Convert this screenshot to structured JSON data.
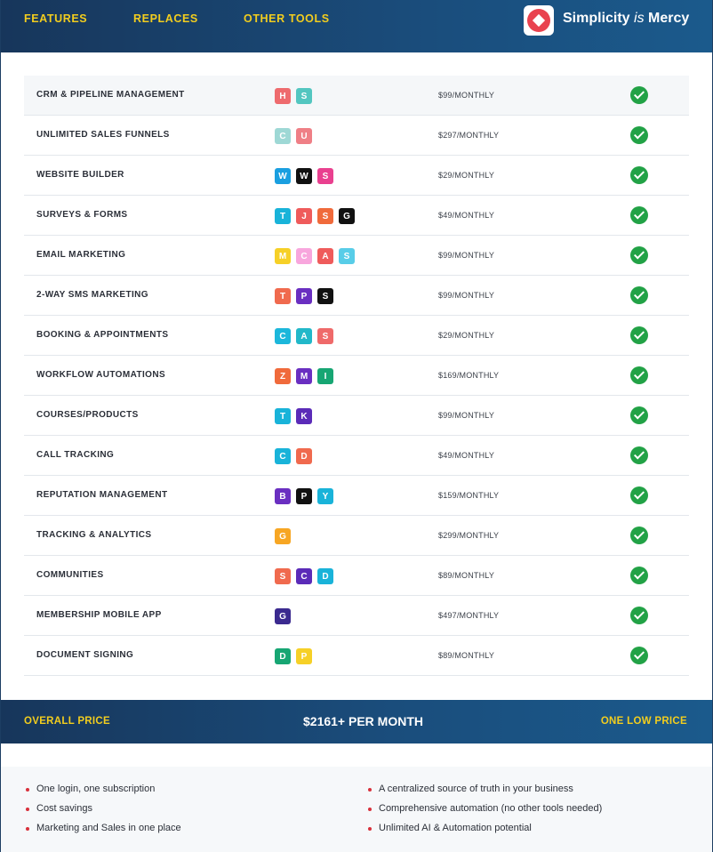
{
  "nav": {
    "features": "FEATURES",
    "replaces": "REPLACES",
    "other_tools": "OTHER TOOLS"
  },
  "brand": {
    "name_part1": "Simplicity",
    "name_em": "is",
    "name_part2": "Mercy",
    "logo_icon": "red-diamond-logo"
  },
  "colors": {
    "header_bg": "#17365b",
    "accent_yellow": "#f2cd1e",
    "check_green": "#22a246",
    "bullet_red": "#d8303b"
  },
  "rows": [
    {
      "feature": "CRM & PIPELINE MANAGEMENT",
      "price": "$99/MONTHLY",
      "tools": [
        [
          "H",
          "#ee6b6e"
        ],
        [
          "S",
          "#53c6c0"
        ]
      ]
    },
    {
      "feature": "UNLIMITED SALES FUNNELS",
      "price": "$297/MONTHLY",
      "tools": [
        [
          "C",
          "#9ed8d5"
        ],
        [
          "U",
          "#ef7f86"
        ]
      ]
    },
    {
      "feature": "WEBSITE BUILDER",
      "price": "$29/MONTHLY",
      "tools": [
        [
          "W",
          "#1a9fe0"
        ],
        [
          "W",
          "#111111"
        ],
        [
          "S",
          "#e9408f"
        ]
      ]
    },
    {
      "feature": "SURVEYS & FORMS",
      "price": "$49/MONTHLY",
      "tools": [
        [
          "T",
          "#19b3d9"
        ],
        [
          "J",
          "#ef5b5b"
        ],
        [
          "S",
          "#f06a3b"
        ],
        [
          "G",
          "#111111"
        ]
      ]
    },
    {
      "feature": "EMAIL MARKETING",
      "price": "$99/MONTHLY",
      "tools": [
        [
          "M",
          "#f6d027"
        ],
        [
          "C",
          "#f8a6dd"
        ],
        [
          "A",
          "#ef5b5b"
        ],
        [
          "S",
          "#58cde8"
        ]
      ]
    },
    {
      "feature": "2-WAY SMS MARKETING",
      "price": "$99/MONTHLY",
      "tools": [
        [
          "T",
          "#f06a4e"
        ],
        [
          "P",
          "#6a2fc1"
        ],
        [
          "S",
          "#111111"
        ]
      ]
    },
    {
      "feature": "BOOKING & APPOINTMENTS",
      "price": "$29/MONTHLY",
      "tools": [
        [
          "C",
          "#1cb7db"
        ],
        [
          "A",
          "#22b8c9"
        ],
        [
          "S",
          "#ef6a6a"
        ]
      ]
    },
    {
      "feature": "WORKFLOW AUTOMATIONS",
      "price": "$169/MONTHLY",
      "tools": [
        [
          "Z",
          "#f06a3b"
        ],
        [
          "M",
          "#6a2fc1"
        ],
        [
          "I",
          "#17a673"
        ]
      ]
    },
    {
      "feature": "COURSES/PRODUCTS",
      "price": "$99/MONTHLY",
      "tools": [
        [
          "T",
          "#19b3d9"
        ],
        [
          "K",
          "#5b2bb8"
        ]
      ]
    },
    {
      "feature": "CALL TRACKING",
      "price": "$49/MONTHLY",
      "tools": [
        [
          "C",
          "#19b3d9"
        ],
        [
          "D",
          "#f06a4e"
        ]
      ]
    },
    {
      "feature": "REPUTATION MANAGEMENT",
      "price": "$159/MONTHLY",
      "tools": [
        [
          "B",
          "#6a2fc1"
        ],
        [
          "P",
          "#111111"
        ],
        [
          "Y",
          "#19b3d9"
        ]
      ]
    },
    {
      "feature": "TRACKING & ANALYTICS",
      "price": "$299/MONTHLY",
      "tools": [
        [
          "G",
          "#f7a623"
        ]
      ]
    },
    {
      "feature": "COMMUNITIES",
      "price": "$89/MONTHLY",
      "tools": [
        [
          "S",
          "#f06a4e"
        ],
        [
          "C",
          "#5b2bb8"
        ],
        [
          "D",
          "#19b3d9"
        ]
      ]
    },
    {
      "feature": "MEMBERSHIP MOBILE APP",
      "price": "$497/MONTHLY",
      "tools": [
        [
          "G",
          "#3b2a8f"
        ]
      ]
    },
    {
      "feature": "DOCUMENT SIGNING",
      "price": "$89/MONTHLY",
      "tools": [
        [
          "D",
          "#17a673"
        ],
        [
          "P",
          "#f6d027"
        ]
      ]
    }
  ],
  "summary": {
    "label": "OVERALL PRICE",
    "total": "$2161+ PER MONTH",
    "tagline": "ONE LOW PRICE"
  },
  "benefits": {
    "left": [
      "One login, one subscription",
      "Cost savings",
      "Marketing and Sales in one place"
    ],
    "right": [
      "A centralized source of truth in your business",
      "Comprehensive automation (no other tools needed)",
      "Unlimited AI & Automation potential"
    ]
  }
}
